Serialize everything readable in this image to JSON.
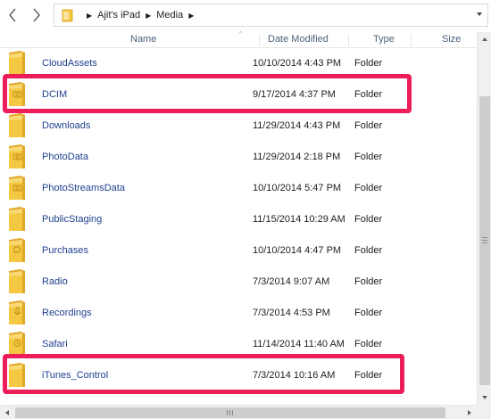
{
  "breadcrumb": [
    "Ajit's iPad",
    "Media"
  ],
  "columns": {
    "name": "Name",
    "date_modified": "Date Modified",
    "type": "Type",
    "size": "Size"
  },
  "rows": [
    {
      "name": "CloudAssets",
      "date": "10/10/2014 4:43 PM",
      "type": "Folder",
      "icon": "folder-icon"
    },
    {
      "name": "DCIM",
      "date": "9/17/2014 4:37 PM",
      "type": "Folder",
      "icon": "camera-folder-icon",
      "highlighted": true
    },
    {
      "name": "Downloads",
      "date": "11/29/2014 4:43 PM",
      "type": "Folder",
      "icon": "folder-icon"
    },
    {
      "name": "PhotoData",
      "date": "11/29/2014 2:18 PM",
      "type": "Folder",
      "icon": "camera-folder-icon"
    },
    {
      "name": "PhotoStreamsData",
      "date": "10/10/2014 5:47 PM",
      "type": "Folder",
      "icon": "camera-folder-icon"
    },
    {
      "name": "PublicStaging",
      "date": "11/15/2014 10:29 AM",
      "type": "Folder",
      "icon": "folder-icon"
    },
    {
      "name": "Purchases",
      "date": "10/10/2014 4:47 PM",
      "type": "Folder",
      "icon": "tag-folder-icon"
    },
    {
      "name": "Radio",
      "date": "7/3/2014 9:07 AM",
      "type": "Folder",
      "icon": "folder-icon"
    },
    {
      "name": "Recordings",
      "date": "7/3/2014 4:53 PM",
      "type": "Folder",
      "icon": "mic-folder-icon"
    },
    {
      "name": "Safari",
      "date": "11/14/2014 11:40 AM",
      "type": "Folder",
      "icon": "clock-folder-icon"
    },
    {
      "name": "iTunes_Control",
      "date": "7/3/2014 10:16 AM",
      "type": "Folder",
      "icon": "folder-icon",
      "highlighted": true
    }
  ],
  "colors": {
    "highlight": "#ed1d5a",
    "folder": "#f5c842",
    "link": "#1f3f8f"
  }
}
